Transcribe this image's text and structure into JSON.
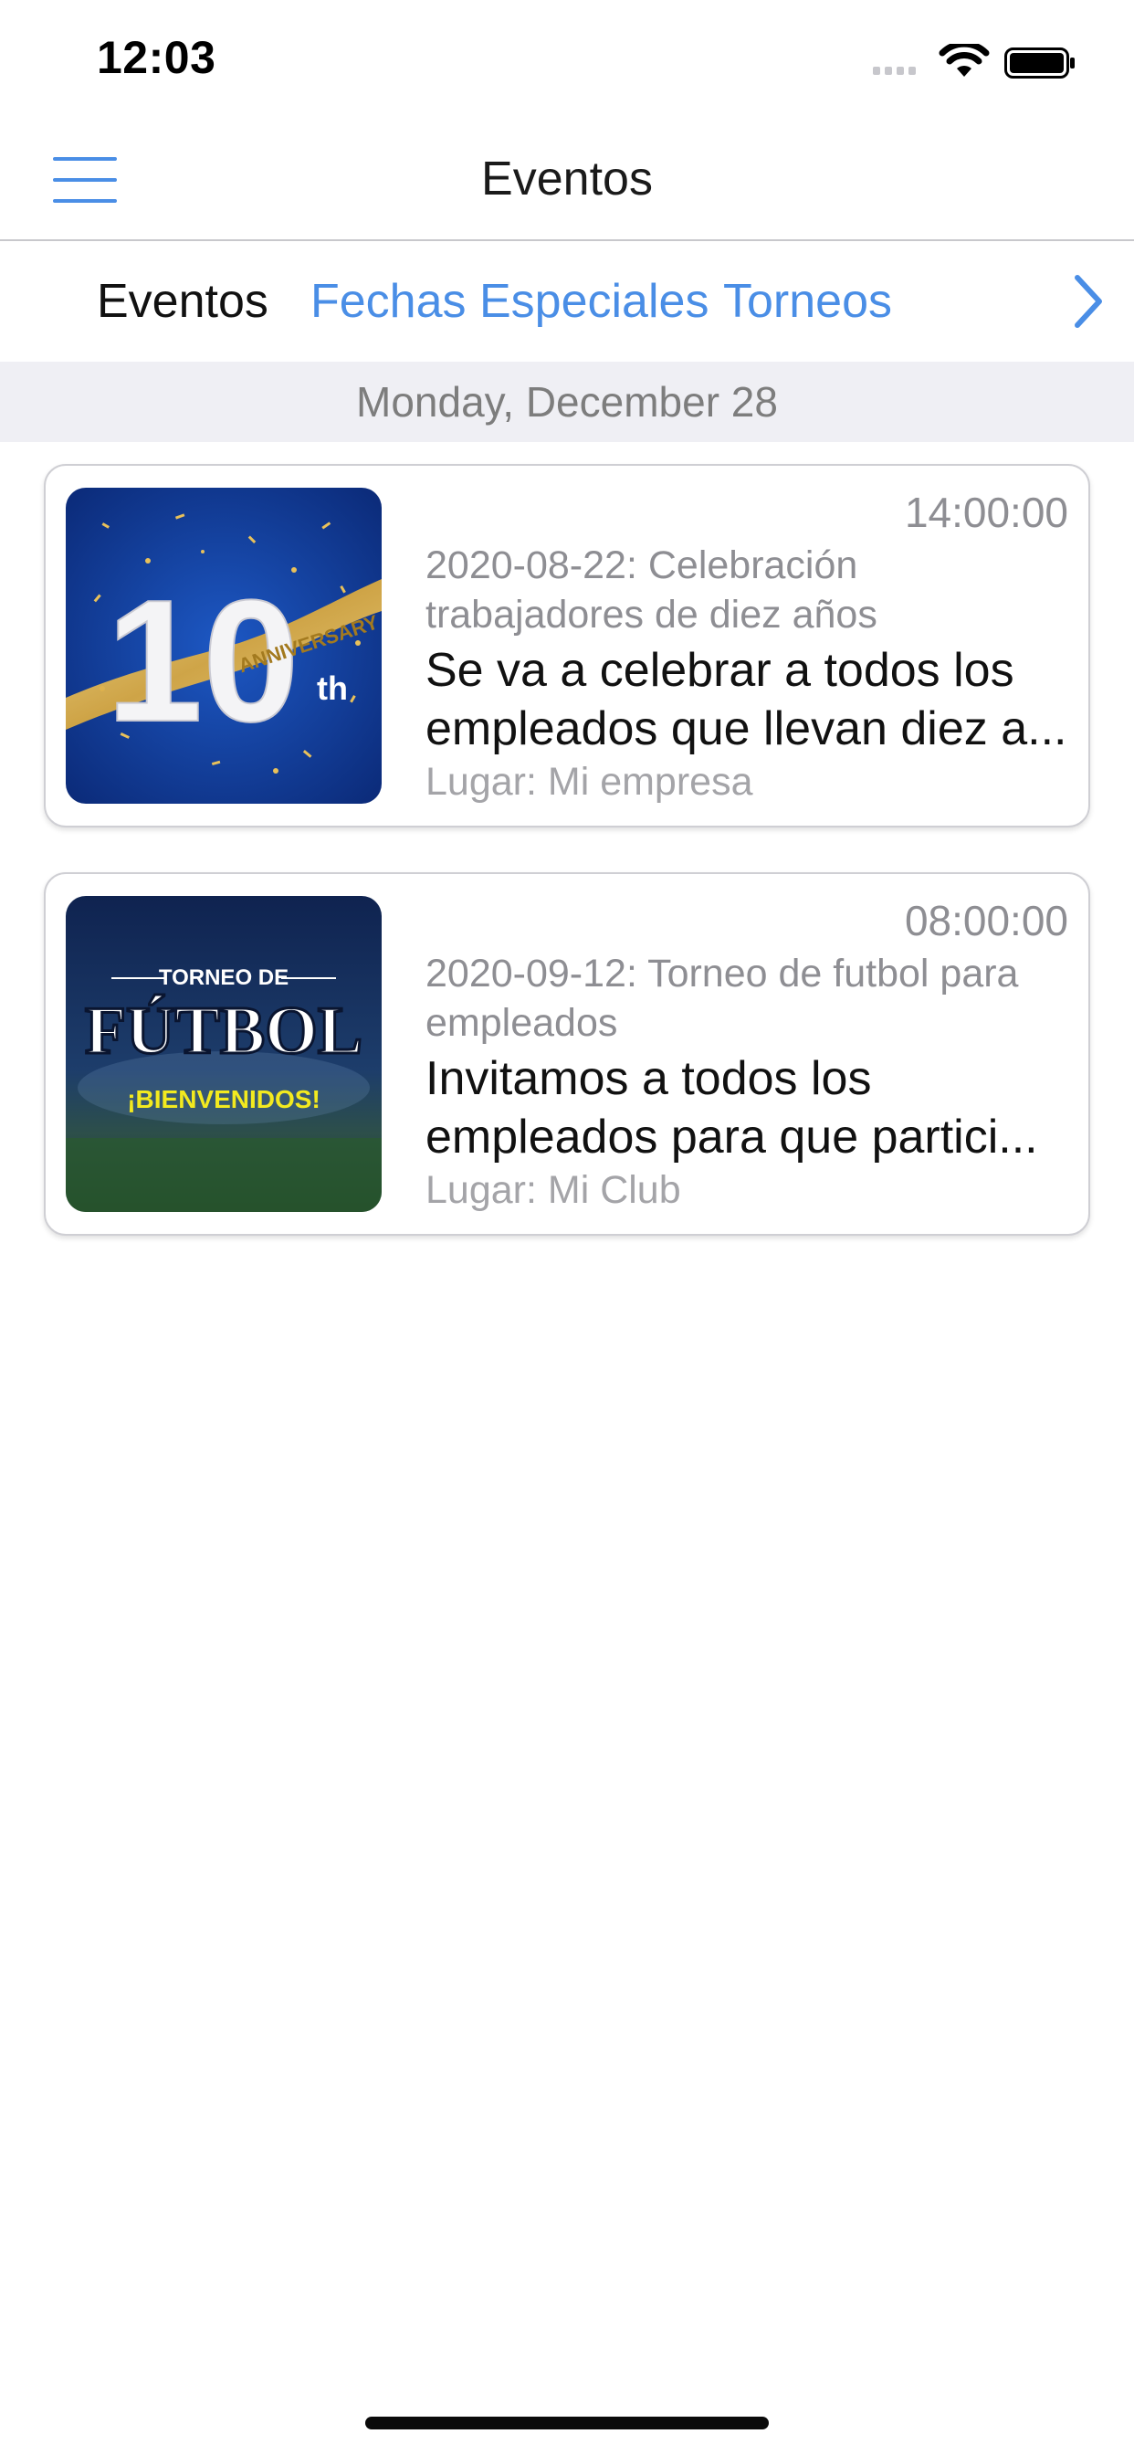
{
  "status_bar": {
    "time": "12:03"
  },
  "nav": {
    "title": "Eventos",
    "menu_icon": "hamburger-menu-icon"
  },
  "tabs": [
    {
      "label": "Eventos",
      "selected": true
    },
    {
      "label": "Fechas Especiales",
      "selected": false
    },
    {
      "label": "Torneos",
      "selected": false
    }
  ],
  "section": {
    "date": "Monday, December 28"
  },
  "events": [
    {
      "time": "14:00:00",
      "subtitle": "2020-08-22: Celebración trabajadores de diez años",
      "description": "Se va a celebrar a todos los empleados que llevan diez a...",
      "place": "Lugar: Mi empresa",
      "image": {
        "number": "10",
        "suffix": "th",
        "ribbon": "ANNIVERSARY"
      }
    },
    {
      "time": "08:00:00",
      "subtitle": "2020-09-12: Torneo de futbol para empleados",
      "description": "Invitamos a todos los empleados para que partici...",
      "place": "Lugar: Mi Club",
      "image": {
        "line1": "TORNEO DE",
        "line2": "FÚTBOL",
        "line3": "¡BIENVENIDOS!"
      }
    }
  ],
  "colors": {
    "accent": "#4a8ee6",
    "section_bg": "#efeff4",
    "secondary_text": "#8e8e93"
  }
}
